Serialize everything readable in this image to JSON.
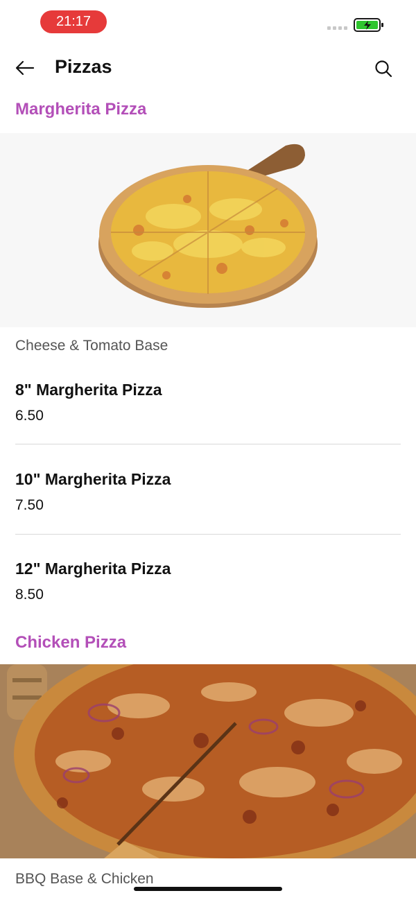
{
  "status_bar": {
    "time": "21:17",
    "battery_icon": "battery-charging-icon",
    "signal_icon": "signal-icon"
  },
  "header": {
    "title": "Pizzas",
    "back_icon": "arrow-left-icon",
    "search_icon": "search-icon"
  },
  "colors": {
    "section_title": "#b34fb8",
    "time_pill": "#e63a3a",
    "battery_green": "#2ec52e"
  },
  "sections": [
    {
      "title": "Margherita Pizza",
      "image": "margherita-pizza-image",
      "description": "Cheese & Tomato Base",
      "items": [
        {
          "name": "8\" Margherita Pizza",
          "price": "6.50"
        },
        {
          "name": "10\" Margherita Pizza",
          "price": "7.50"
        },
        {
          "name": "12\" Margherita Pizza",
          "price": "8.50"
        }
      ]
    },
    {
      "title": "Chicken Pizza",
      "image": "bbq-chicken-pizza-image",
      "description": "BBQ Base & Chicken",
      "items": []
    }
  ]
}
